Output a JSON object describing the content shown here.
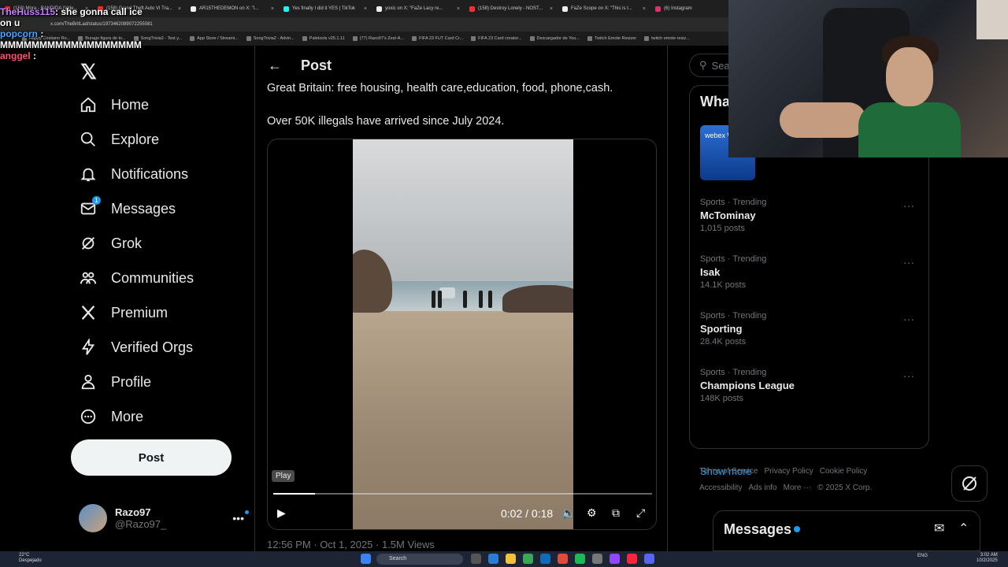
{
  "browser": {
    "tabs": [
      {
        "label": "(158) Mora - BANDIDA (Vide...",
        "color": "#ff2d2d"
      },
      {
        "label": "(158) Grand Theft Auto VI Tra...",
        "color": "#ff2d2d"
      },
      {
        "label": "AR15THEDEMON on X: \"I...",
        "color": "#eeeeee"
      },
      {
        "label": "Yes finally I did it YES | TikTok",
        "color": "#25f4ee"
      },
      {
        "label": "yoxic on X: \"FaZe Lacy re...",
        "color": "#eeeeee"
      },
      {
        "label": "(158) Destroy Lonely - NOST...",
        "color": "#ff2d2d"
      },
      {
        "label": "FaZe Scope on X: \"This is I...",
        "color": "#eeeeee"
      },
      {
        "label": "(6) Instagram",
        "color": "#e1306c"
      }
    ],
    "url": "x.com/TheBritLad/status/1973462089072255081",
    "bookmarks": [
      "Happy Cristiano Ro...",
      "Burago figura de to...",
      "SongTrivia2 - Test y...",
      "App Store / Streami...",
      "SongTrivia2 - Advin...",
      "Paletools v25.1.11",
      "(77) Razo97's Zest-A...",
      "FIFA 23 FUT Card Cr...",
      "FIFA 23 Card creator...",
      "Descargador de You...",
      "Twitch Emote Resizer",
      "twitch emote resiz..."
    ]
  },
  "chat": [
    {
      "user": "TheHuss115",
      "color": "#c77dff",
      "message": ": she gonna call ice"
    },
    {
      "user": "",
      "color": "#ffffff",
      "message": "on u"
    },
    {
      "user": "popcorn",
      "color": "#4ea3ff",
      "message": " :"
    },
    {
      "user": "",
      "color": "#ffffff",
      "message": "MMMMMMMMMMMMMMMMMM"
    },
    {
      "user": "anggel",
      "color": "#ff4d6d",
      "message": " :"
    }
  ],
  "nav": {
    "logo": "𝕏",
    "items": [
      {
        "label": "Home",
        "icon": "home-icon"
      },
      {
        "label": "Explore",
        "icon": "search-icon"
      },
      {
        "label": "Notifications",
        "icon": "bell-icon"
      },
      {
        "label": "Messages",
        "icon": "envelope-icon",
        "badge": "1"
      },
      {
        "label": "Grok",
        "icon": "grok-icon"
      },
      {
        "label": "Communities",
        "icon": "communities-icon"
      },
      {
        "label": "Premium",
        "icon": "x-premium-icon"
      },
      {
        "label": "Verified Orgs",
        "icon": "lightning-icon"
      },
      {
        "label": "Profile",
        "icon": "person-icon"
      },
      {
        "label": "More",
        "icon": "more-circle-icon"
      }
    ],
    "post_button": "Post",
    "account": {
      "name": "Razo97",
      "handle": "@Razo97_"
    }
  },
  "post": {
    "header": "Post",
    "line1": "Great Britain: free housing, health care,education, food, phone,cash.",
    "line2": "Over 50K illegals have arrived since July 2024.",
    "video": {
      "tooltip": "Play",
      "time": "0:02 / 0:18",
      "progress": 0.11
    },
    "meta": "12:56 PM · Oct 1, 2025 · 1.5M Views"
  },
  "sidebar": {
    "search_placeholder": "Search",
    "trends_title": "What's happening",
    "promo_text": "webex Watch",
    "trends": [
      {
        "category": "Sports · Trending",
        "name": "McTominay",
        "count": "1,015 posts"
      },
      {
        "category": "Sports · Trending",
        "name": "Isak",
        "count": "14.1K posts"
      },
      {
        "category": "Sports · Trending",
        "name": "Sporting",
        "count": "28.4K posts"
      },
      {
        "category": "Sports · Trending",
        "name": "Champions League",
        "count": "148K posts"
      }
    ],
    "show_more": "Show more",
    "footer": [
      "Terms of Service",
      "Privacy Policy",
      "Cookie Policy",
      "Accessibility",
      "Ads info",
      "More ···",
      "© 2025 X Corp."
    ]
  },
  "messages_drawer": {
    "title": "Messages"
  },
  "taskbar": {
    "weather_temp": "22°C",
    "weather_desc": "Despejado",
    "search": "Search",
    "lang": "ENG",
    "time": "3:02 AM",
    "date": "10/2/2025"
  }
}
